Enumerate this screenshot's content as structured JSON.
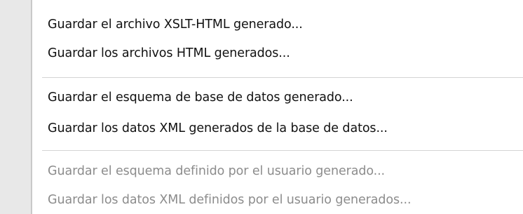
{
  "menu": {
    "items": [
      {
        "label": "Guardar el archivo XSLT-HTML generado...",
        "enabled": true
      },
      {
        "label": "Guardar los archivos HTML generados...",
        "enabled": true
      },
      {
        "label": "Guardar el esquema de base de datos generado...",
        "enabled": true
      },
      {
        "label": "Guardar los datos XML generados de la base de datos...",
        "enabled": true
      },
      {
        "label": "Guardar el esquema definido por el usuario generado...",
        "enabled": false
      },
      {
        "label": "Guardar los datos XML definidos por el usuario generados...",
        "enabled": false
      }
    ]
  },
  "colors": {
    "enabled_text": "#111111",
    "disabled_text": "#8c8c8c",
    "gutter": "#e8e8e8",
    "separator": "#d4d4d4"
  }
}
